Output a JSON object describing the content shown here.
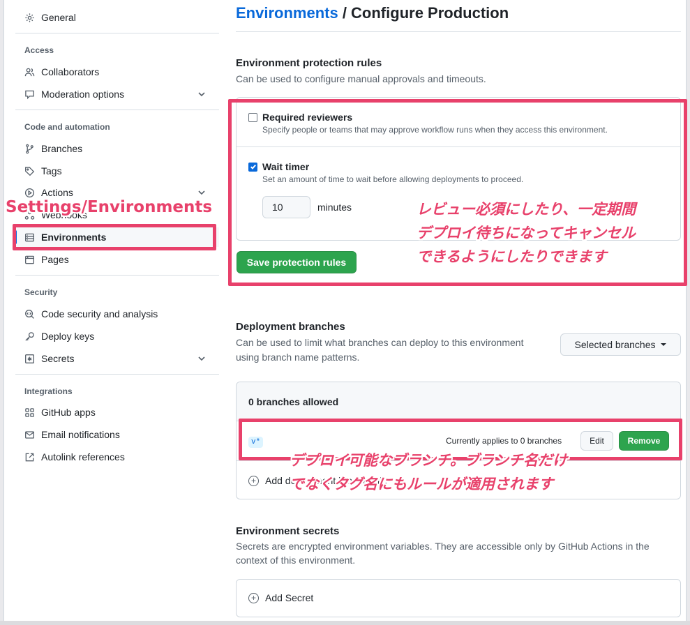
{
  "sidebar": {
    "general": "General",
    "access_heading": "Access",
    "collaborators": "Collaborators",
    "moderation": "Moderation options",
    "code_heading": "Code and automation",
    "branches": "Branches",
    "tags": "Tags",
    "actions": "Actions",
    "webhooks": "Webhooks",
    "environments": "Environments",
    "pages": "Pages",
    "security_heading": "Security",
    "code_security": "Code security and analysis",
    "deploy_keys": "Deploy keys",
    "secrets": "Secrets",
    "integrations_heading": "Integrations",
    "github_apps": "GitHub apps",
    "email_notifications": "Email notifications",
    "autolink": "Autolink references"
  },
  "header": {
    "breadcrumb_link": "Environments",
    "breadcrumb_sep": " / ",
    "title": "Configure Production"
  },
  "protection": {
    "title": "Environment protection rules",
    "desc": "Can be used to configure manual approvals and timeouts.",
    "required_reviewers_label": "Required reviewers",
    "required_reviewers_checked": false,
    "required_reviewers_desc": "Specify people or teams that may approve workflow runs when they access this environment.",
    "wait_timer_label": "Wait timer",
    "wait_timer_checked": true,
    "wait_timer_desc": "Set an amount of time to wait before allowing deployments to proceed.",
    "minutes_value": "10",
    "minutes_label": "minutes",
    "save_button": "Save protection rules"
  },
  "deployment": {
    "title": "Deployment branches",
    "desc_line1": "Can be used to limit what branches can deploy to this environment",
    "desc_line2": "using branch name patterns.",
    "select_label": "Selected branches",
    "allowed_header": "0 branches allowed",
    "pattern": "v*",
    "applies_text": "Currently applies to 0 branches",
    "edit_button": "Edit",
    "remove_button": "Remove",
    "add_rule": "Add deployment branch rule"
  },
  "secrets": {
    "title": "Environment secrets",
    "desc_line1": "Secrets are encrypted environment variables. They are accessible only by GitHub Actions in the",
    "desc_line2": "context of this environment.",
    "add_secret": "Add Secret"
  },
  "annotations": {
    "settings_label": "Settings/Environments",
    "protection_note_1": "レビュー必須にしたり、一定期間",
    "protection_note_2": "デプロイ待ちになってキャンセル",
    "protection_note_3": "できるようにしたりできます",
    "branch_note_1": "デプロイ可能なブランチ。ブランチ名だけ",
    "branch_note_2": "でなくタグ名にもルールが適用されます"
  },
  "colors": {
    "accent": "#0969da",
    "primary_button": "#2da44e",
    "annotation": "#e8416b"
  }
}
